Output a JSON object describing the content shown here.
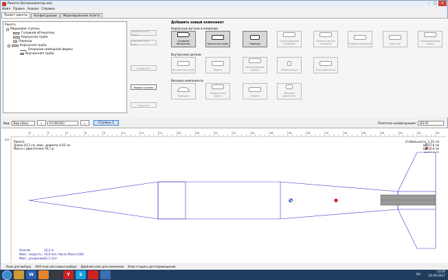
{
  "window": {
    "title": "Ракета (Ботинкомотор.ork)"
  },
  "menu": [
    "Файл",
    "Правка",
    "Анализ",
    "Справка"
  ],
  "tabs": [
    "Проект ракеты",
    "Конфигурации",
    "Моделирование полета"
  ],
  "tree": {
    "root": "Ракета",
    "stage": "Маршевая ступень",
    "nose": "Головной обтекатель",
    "body": "Корпусная труба",
    "transition": "Переход",
    "body2": "Корпусная труба",
    "fins": "Оперение свободной формы",
    "inner": "Внутренняя труба"
  },
  "actions": {
    "up": "Переместить вверх",
    "down": "Переместить вниз",
    "edit": "Изменить",
    "new_stage": "Новая ступень",
    "delete": "Удалить"
  },
  "panel": {
    "title": "Добавить новый компонент",
    "sec1": "Корпусные детали и оперение",
    "sec1_items": [
      "Головной обтекатель",
      "Корпусная труба",
      "Переход",
      "Трапецевидное оперение",
      "Эллиптическое оперение",
      "Свободной формы",
      "Тубы пол",
      "Прямолинейные ножки"
    ],
    "sec2": "Внутренние детали",
    "sec2_items": [
      "Внутренняя труба",
      "Муфта",
      "Центрирующее кольцо",
      "Перегородка",
      "Узел двигателя"
    ],
    "sec3": "Весовые компоненты",
    "sec3_items": [
      "Парашют",
      "Парашютная лента",
      "Стропа",
      "Весовой компонент"
    ]
  },
  "toolbar": {
    "view_label": "Вид:",
    "view_value": "Вид сбоку",
    "angle_value": "Fd (90,0%)",
    "stage_button": "Ступень 1",
    "config_label": "Полетная конфигурация:",
    "config_value": "[E2-6]"
  },
  "canvas": {
    "rocket_name": "Ракета",
    "length_line": "Длина 43,2 см, макс. диаметр 4,02 см",
    "mass_line": "Масса с двигателем 76,7 g",
    "stability": "Стабильность: 1,15 cal",
    "cg": "ЦТ:27,6 см",
    "cp": "ЦД:32,6 см",
    "mach": "при M=0,30",
    "apogee_label": "Апогей:",
    "apogee_value": "32,2 m",
    "speed_label": "Макс. скорость:",
    "speed_value": "19,6 m/s  (Число Маха 0,06)",
    "accel_label": "Макс. ускорение:",
    "accel_value": "41,1 m/s²",
    "ruler": [
      "0",
      "2",
      "4",
      "6",
      "8",
      "10",
      "12",
      "14",
      "16",
      "18",
      "20",
      "22",
      "24",
      "26",
      "28",
      "30",
      "32",
      "34",
      "36",
      "38",
      "40",
      "42",
      "44"
    ],
    "side_ruler_unit": "cm"
  },
  "status": [
    "Клик для выбора",
    "Shift-клик для новых выбора",
    "Двойной клик для изменения",
    "Клик+тащить для перемещения"
  ],
  "taskbar": {
    "time": "13:50",
    "date": "24.09.2017",
    "lang": "RU"
  }
}
